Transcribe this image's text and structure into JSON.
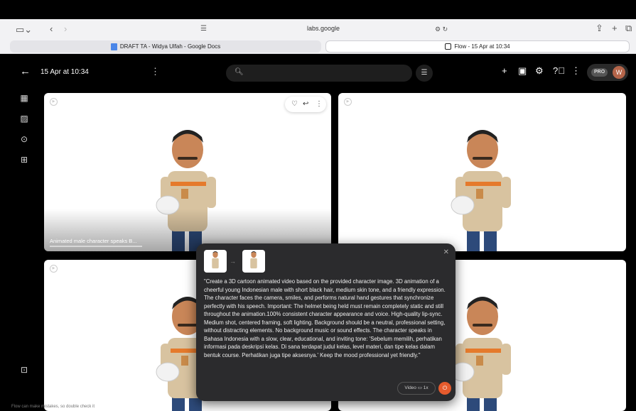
{
  "browser": {
    "url": "labs.google",
    "tabs": [
      {
        "label": "DRAFT TA - Widya Ulfah - Google Docs",
        "active": false
      },
      {
        "label": "Flow - 15 Apr at 10:34",
        "active": true
      }
    ]
  },
  "app": {
    "title": "15 Apr at 10:34",
    "search_placeholder": "",
    "pro_badge": "PRO",
    "avatar_initial": "W",
    "icons": {
      "back": "arrow-left-icon",
      "more": "more-vertical-icon",
      "search": "search-icon",
      "filter": "filter-icon",
      "add": "plus-icon",
      "scenes": "film-icon",
      "settings": "gear-icon",
      "help": "help-icon"
    }
  },
  "sidebar": {
    "items": [
      "grid-icon",
      "image-icon",
      "play-circle-icon",
      "folder-upload-icon",
      "download-box-icon"
    ]
  },
  "cards": [
    {
      "caption": "Animated male character speaks B...",
      "show_actions": true
    },
    {
      "caption": "",
      "show_actions": false
    },
    {
      "caption": "",
      "show_actions": false
    },
    {
      "caption": "",
      "show_actions": false
    }
  ],
  "prompt_popup": {
    "text": "\"Create a 3D cartoon animated video based on the provided character image. 3D animation of a cheerful young Indonesian male with short black hair, medium skin tone, and a friendly expression. The character faces the camera, smiles, and performs natural hand gestures that synchronize perfectly with his speech. Important: The helmet being held must remain completely static and still throughout the animation.100% consistent character appearance and voice. High-quality lip-sync. Medium shot, centered framing, soft lighting. Background should be a neutral, professional setting, without distracting elements. No background music or sound effects. The character speaks in Bahasa Indonesia with a slow, clear, educational, and inviting tone: 'Sebelum memilih, perhatikan informasi pada deskripsi kelas. Di sana terdapat judul kelas, level materi, dan tipe kelas dalam bentuk course. Perhatikan juga tipe aksesnya.' Keep the mood professional yet friendly.\"",
    "mode_label": "Video",
    "count_label": "1x"
  },
  "footer_note": "Flow can make mistakes, so double check it",
  "colors": {
    "accent": "#e65b2d",
    "avatar": "#b5654a"
  }
}
